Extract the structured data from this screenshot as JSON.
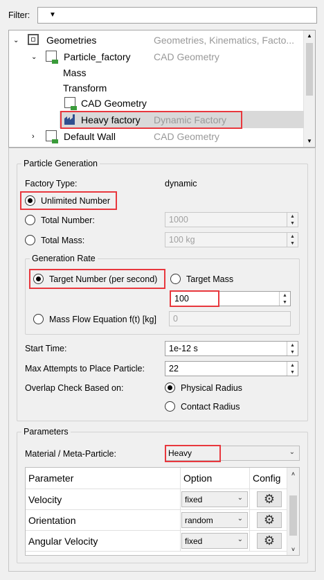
{
  "filter": {
    "label": "Filter:",
    "value": ""
  },
  "tree": {
    "rows": [
      {
        "name": "Geometries",
        "type": "Geometries, Kinematics, Facto..."
      },
      {
        "name": "Particle_factory",
        "type": "CAD Geometry"
      },
      {
        "name": "Mass",
        "type": ""
      },
      {
        "name": "Transform",
        "type": ""
      },
      {
        "name": "CAD Geometry",
        "type": ""
      },
      {
        "name": "Heavy factory",
        "type": "Dynamic Factory"
      },
      {
        "name": "Default Wall",
        "type": "CAD Geometry"
      }
    ]
  },
  "particle_generation": {
    "title": "Particle Generation",
    "factory_type_label": "Factory Type:",
    "factory_type_value": "dynamic",
    "unlimited_label": "Unlimited Number",
    "total_number_label": "Total Number:",
    "total_number_value": "1000",
    "total_mass_label": "Total Mass:",
    "total_mass_value": "100 kg",
    "generation_rate": {
      "title": "Generation Rate",
      "target_number_label": "Target Number (per second)",
      "target_mass_label": "Target Mass",
      "rate_value": "100",
      "mass_flow_label": "Mass Flow Equation f(t) [kg]",
      "mass_flow_value": "0"
    },
    "start_time_label": "Start Time:",
    "start_time_value": "1e-12 s",
    "max_attempts_label": "Max Attempts to Place Particle:",
    "max_attempts_value": "22",
    "overlap_label": "Overlap Check Based on:",
    "physical_radius_label": "Physical Radius",
    "contact_radius_label": "Contact Radius"
  },
  "parameters": {
    "title": "Parameters",
    "material_label": "Material / Meta-Particle:",
    "material_value": "Heavy",
    "columns": [
      "Parameter",
      "Option",
      "Config"
    ],
    "rows": [
      {
        "parameter": "Velocity",
        "option": "fixed"
      },
      {
        "parameter": "Orientation",
        "option": "random"
      },
      {
        "parameter": "Angular Velocity",
        "option": "fixed"
      }
    ]
  },
  "colors": {
    "highlight": "#e8373d",
    "selection": "#cde4f7"
  }
}
